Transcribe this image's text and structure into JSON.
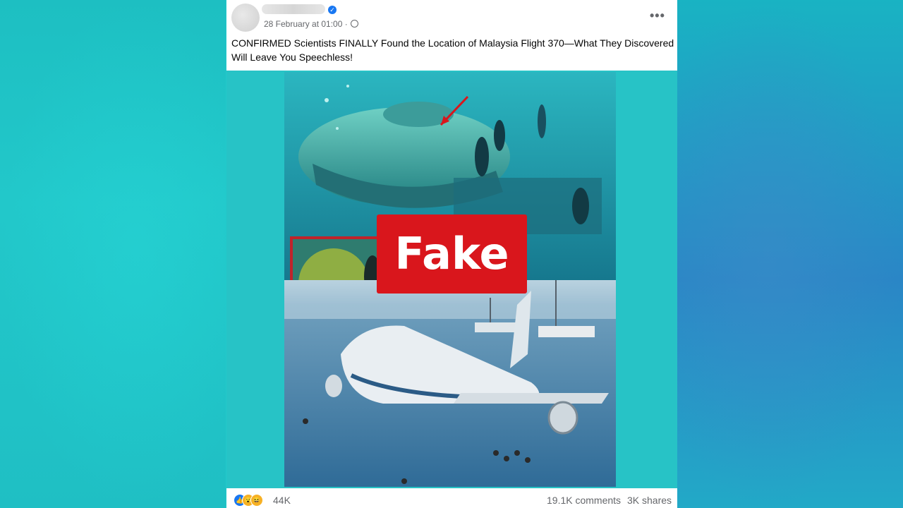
{
  "post": {
    "timestamp": "28 February at 01:00 ·",
    "caption": "CONFIRMED Scientists FINALLY Found the Location of Malaysia Flight 370—What They Discovered Will Leave You Speechless!",
    "label": "Fake"
  },
  "footer": {
    "reaction_count": "44K",
    "comments": "19.1K comments",
    "shares": "3K shares"
  },
  "icons": {
    "verified": "verified-badge-icon",
    "globe": "globe-icon",
    "more": "more-options-icon",
    "reactions": [
      "like-icon",
      "wow-icon",
      "haha-icon"
    ]
  },
  "colors": {
    "fake_badge": "#d9161c",
    "background": "#21c9cb",
    "link_blue": "#1877f2"
  }
}
